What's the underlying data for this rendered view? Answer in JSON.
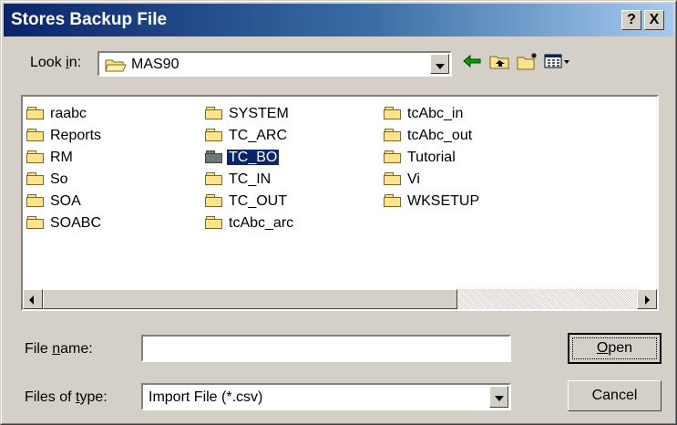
{
  "dialog": {
    "title": "Stores Backup File",
    "title_buttons": {
      "help": "?",
      "close": "X"
    }
  },
  "lookin": {
    "label_pre": "Look ",
    "label_u": "i",
    "label_post": "n:",
    "value": "MAS90"
  },
  "toolbar": {
    "icons": [
      "back-arrow-icon",
      "up-one-level-icon",
      "new-folder-icon",
      "view-menu-icon"
    ]
  },
  "folders": {
    "col1": [
      "raabc",
      "Reports",
      "RM",
      "So",
      "SOA",
      "SOABC"
    ],
    "col2": [
      "SYSTEM",
      "TC_ARC",
      "TC_BO",
      "TC_IN",
      "TC_OUT",
      "tcAbc_arc"
    ],
    "col3": [
      "tcAbc_in",
      "tcAbc_out",
      "Tutorial",
      "Vi",
      "WKSETUP"
    ],
    "selected": "TC_BO"
  },
  "filename": {
    "label_pre": "File ",
    "label_u": "n",
    "label_post": "ame:",
    "value": ""
  },
  "filetype": {
    "label_pre": "Files of ",
    "label_u": "t",
    "label_post": "ype:",
    "value": "Import File (*.csv)"
  },
  "buttons": {
    "open_u": "O",
    "open_rest": "pen",
    "cancel": "Cancel"
  },
  "colors": {
    "titlebar_start": "#0a246a",
    "titlebar_end": "#a6caf0",
    "face": "#d4d0c8",
    "selection": "#0a246a"
  }
}
